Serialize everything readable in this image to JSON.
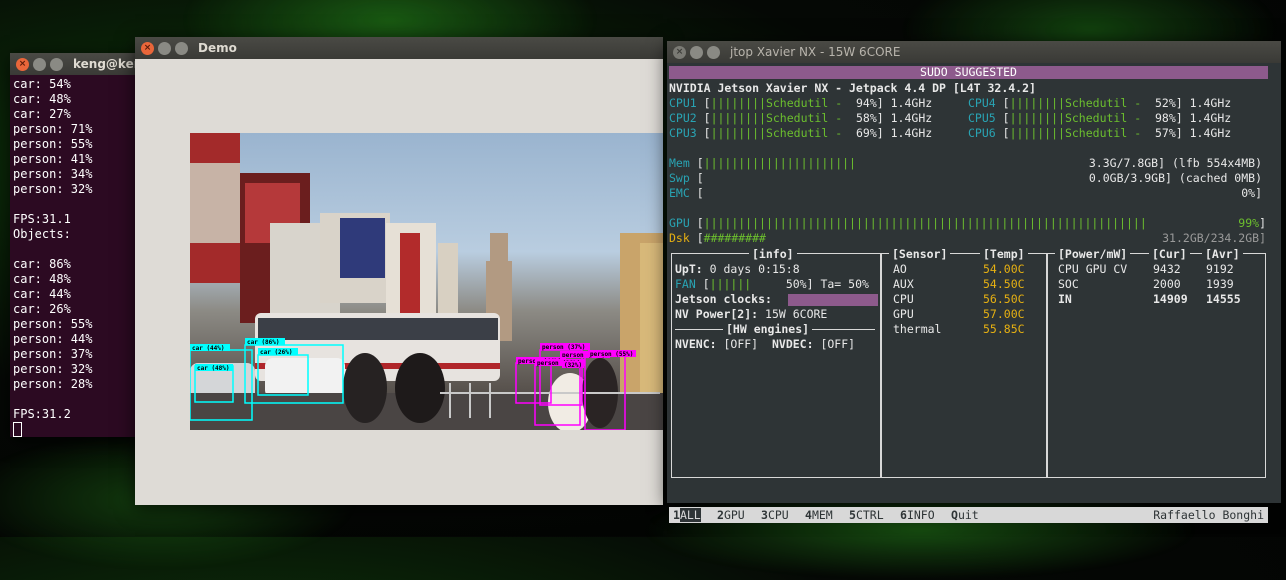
{
  "terminal": {
    "title": "keng@ken",
    "lines": [
      "car: 54%",
      "car: 48%",
      "car: 27%",
      "person: 71%",
      "person: 55%",
      "person: 41%",
      "person: 34%",
      "person: 32%",
      "",
      "FPS:31.1",
      "Objects:",
      "",
      "car: 86%",
      "car: 48%",
      "car: 44%",
      "car: 26%",
      "person: 55%",
      "person: 44%",
      "person: 37%",
      "person: 32%",
      "person: 28%",
      "",
      "FPS:31.2"
    ]
  },
  "demo": {
    "title": "Demo",
    "detections": [
      {
        "label": "car (44%)",
        "color": "#00ffff"
      },
      {
        "label": "car (86%)",
        "color": "#00ffff"
      },
      {
        "label": "car (26%)",
        "color": "#00ffff"
      },
      {
        "label": "car (48%)",
        "color": "#00ffff"
      },
      {
        "label": "person (37%)",
        "color": "#ff00ff"
      },
      {
        "label": "person (55%)",
        "color": "#ff00ff"
      },
      {
        "label": "person (55%)",
        "color": "#ff00ff"
      },
      {
        "label": "person (44%)",
        "color": "#ff00ff"
      },
      {
        "label": "person (28%)",
        "color": "#ff00ff"
      },
      {
        "label": "(32%)",
        "color": "#ff00ff"
      }
    ]
  },
  "jtop": {
    "title": "jtop Xavier NX - 15W 6CORE",
    "banner": "SUDO SUGGESTED",
    "board": "NVIDIA Jetson Xavier NX - Jetpack 4.4 DP [L4T 32.4.2]",
    "cpus": [
      {
        "name": "CPU1",
        "bar": "||||||||",
        "gov": "Schedutil -",
        "pct": "94%",
        "freq": "1.4GHz"
      },
      {
        "name": "CPU2",
        "bar": "||||||||",
        "gov": "Schedutil -",
        "pct": "58%",
        "freq": "1.4GHz"
      },
      {
        "name": "CPU3",
        "bar": "||||||||",
        "gov": "Schedutil -",
        "pct": "69%",
        "freq": "1.4GHz"
      },
      {
        "name": "CPU4",
        "bar": "||||||||",
        "gov": "Schedutil -",
        "pct": "52%",
        "freq": "1.4GHz"
      },
      {
        "name": "CPU5",
        "bar": "||||||||",
        "gov": "Schedutil -",
        "pct": "98%",
        "freq": "1.4GHz"
      },
      {
        "name": "CPU6",
        "bar": "||||||||",
        "gov": "Schedutil -",
        "pct": "57%",
        "freq": "1.4GHz"
      }
    ],
    "mem": {
      "label": "Mem",
      "bar": "||||||||||||||||||||||",
      "value": "3.3G/7.8GB",
      "extra": "(lfb 554x4MB)"
    },
    "swp": {
      "label": "Swp",
      "value": "0.0GB/3.9GB",
      "extra": "(cached 0MB)"
    },
    "emc": {
      "label": "EMC",
      "value": "0%"
    },
    "gpu": {
      "label": "GPU",
      "bar": "||||||||||||||||||||||||||||||||||||||||||||||||||||||||||||||||",
      "value": "99%"
    },
    "dsk": {
      "label": "Dsk",
      "bar": "#########",
      "value": "31.2GB/234.2GB"
    },
    "info": {
      "title": "[info]",
      "uptime_label": "UpT:",
      "uptime": "0 days 0:15:8",
      "fan_label": "FAN",
      "fan_bar": "||||||",
      "fan_pct": "50%]",
      "fan_ta": "Ta= 50%",
      "clocks_label": "Jetson clocks:",
      "nvpower_label": "NV Power[2]:",
      "nvpower": "15W 6CORE",
      "hw_title": "[HW engines]",
      "nvenc_label": "NVENC:",
      "nvenc": "[OFF]",
      "nvdec_label": "NVDEC:",
      "nvdec": "[OFF]"
    },
    "sensor": {
      "title": "[Sensor]",
      "temp_title": "[Temp]",
      "rows": [
        {
          "name": "AO",
          "temp": "54.00C"
        },
        {
          "name": "AUX",
          "temp": "54.50C"
        },
        {
          "name": "CPU",
          "temp": "56.50C"
        },
        {
          "name": "GPU",
          "temp": "57.00C"
        },
        {
          "name": "thermal",
          "temp": "55.85C"
        }
      ]
    },
    "power": {
      "title": "[Power/mW]",
      "cur_title": "[Cur]",
      "avr_title": "[Avr]",
      "rows": [
        {
          "name": "CPU GPU CV",
          "cur": "9432",
          "avr": "9192"
        },
        {
          "name": "SOC",
          "cur": "2000",
          "avr": "1939"
        },
        {
          "name": "IN",
          "cur": "14909",
          "avr": "14555"
        }
      ]
    },
    "menu": [
      {
        "key": "1",
        "label": "ALL"
      },
      {
        "key": "2",
        "label": "GPU"
      },
      {
        "key": "3",
        "label": "CPU"
      },
      {
        "key": "4",
        "label": "MEM"
      },
      {
        "key": "5",
        "label": "CTRL"
      },
      {
        "key": "6",
        "label": "INFO"
      },
      {
        "key": "Q",
        "label": "uit"
      }
    ],
    "author": "Raffaello Bonghi"
  }
}
